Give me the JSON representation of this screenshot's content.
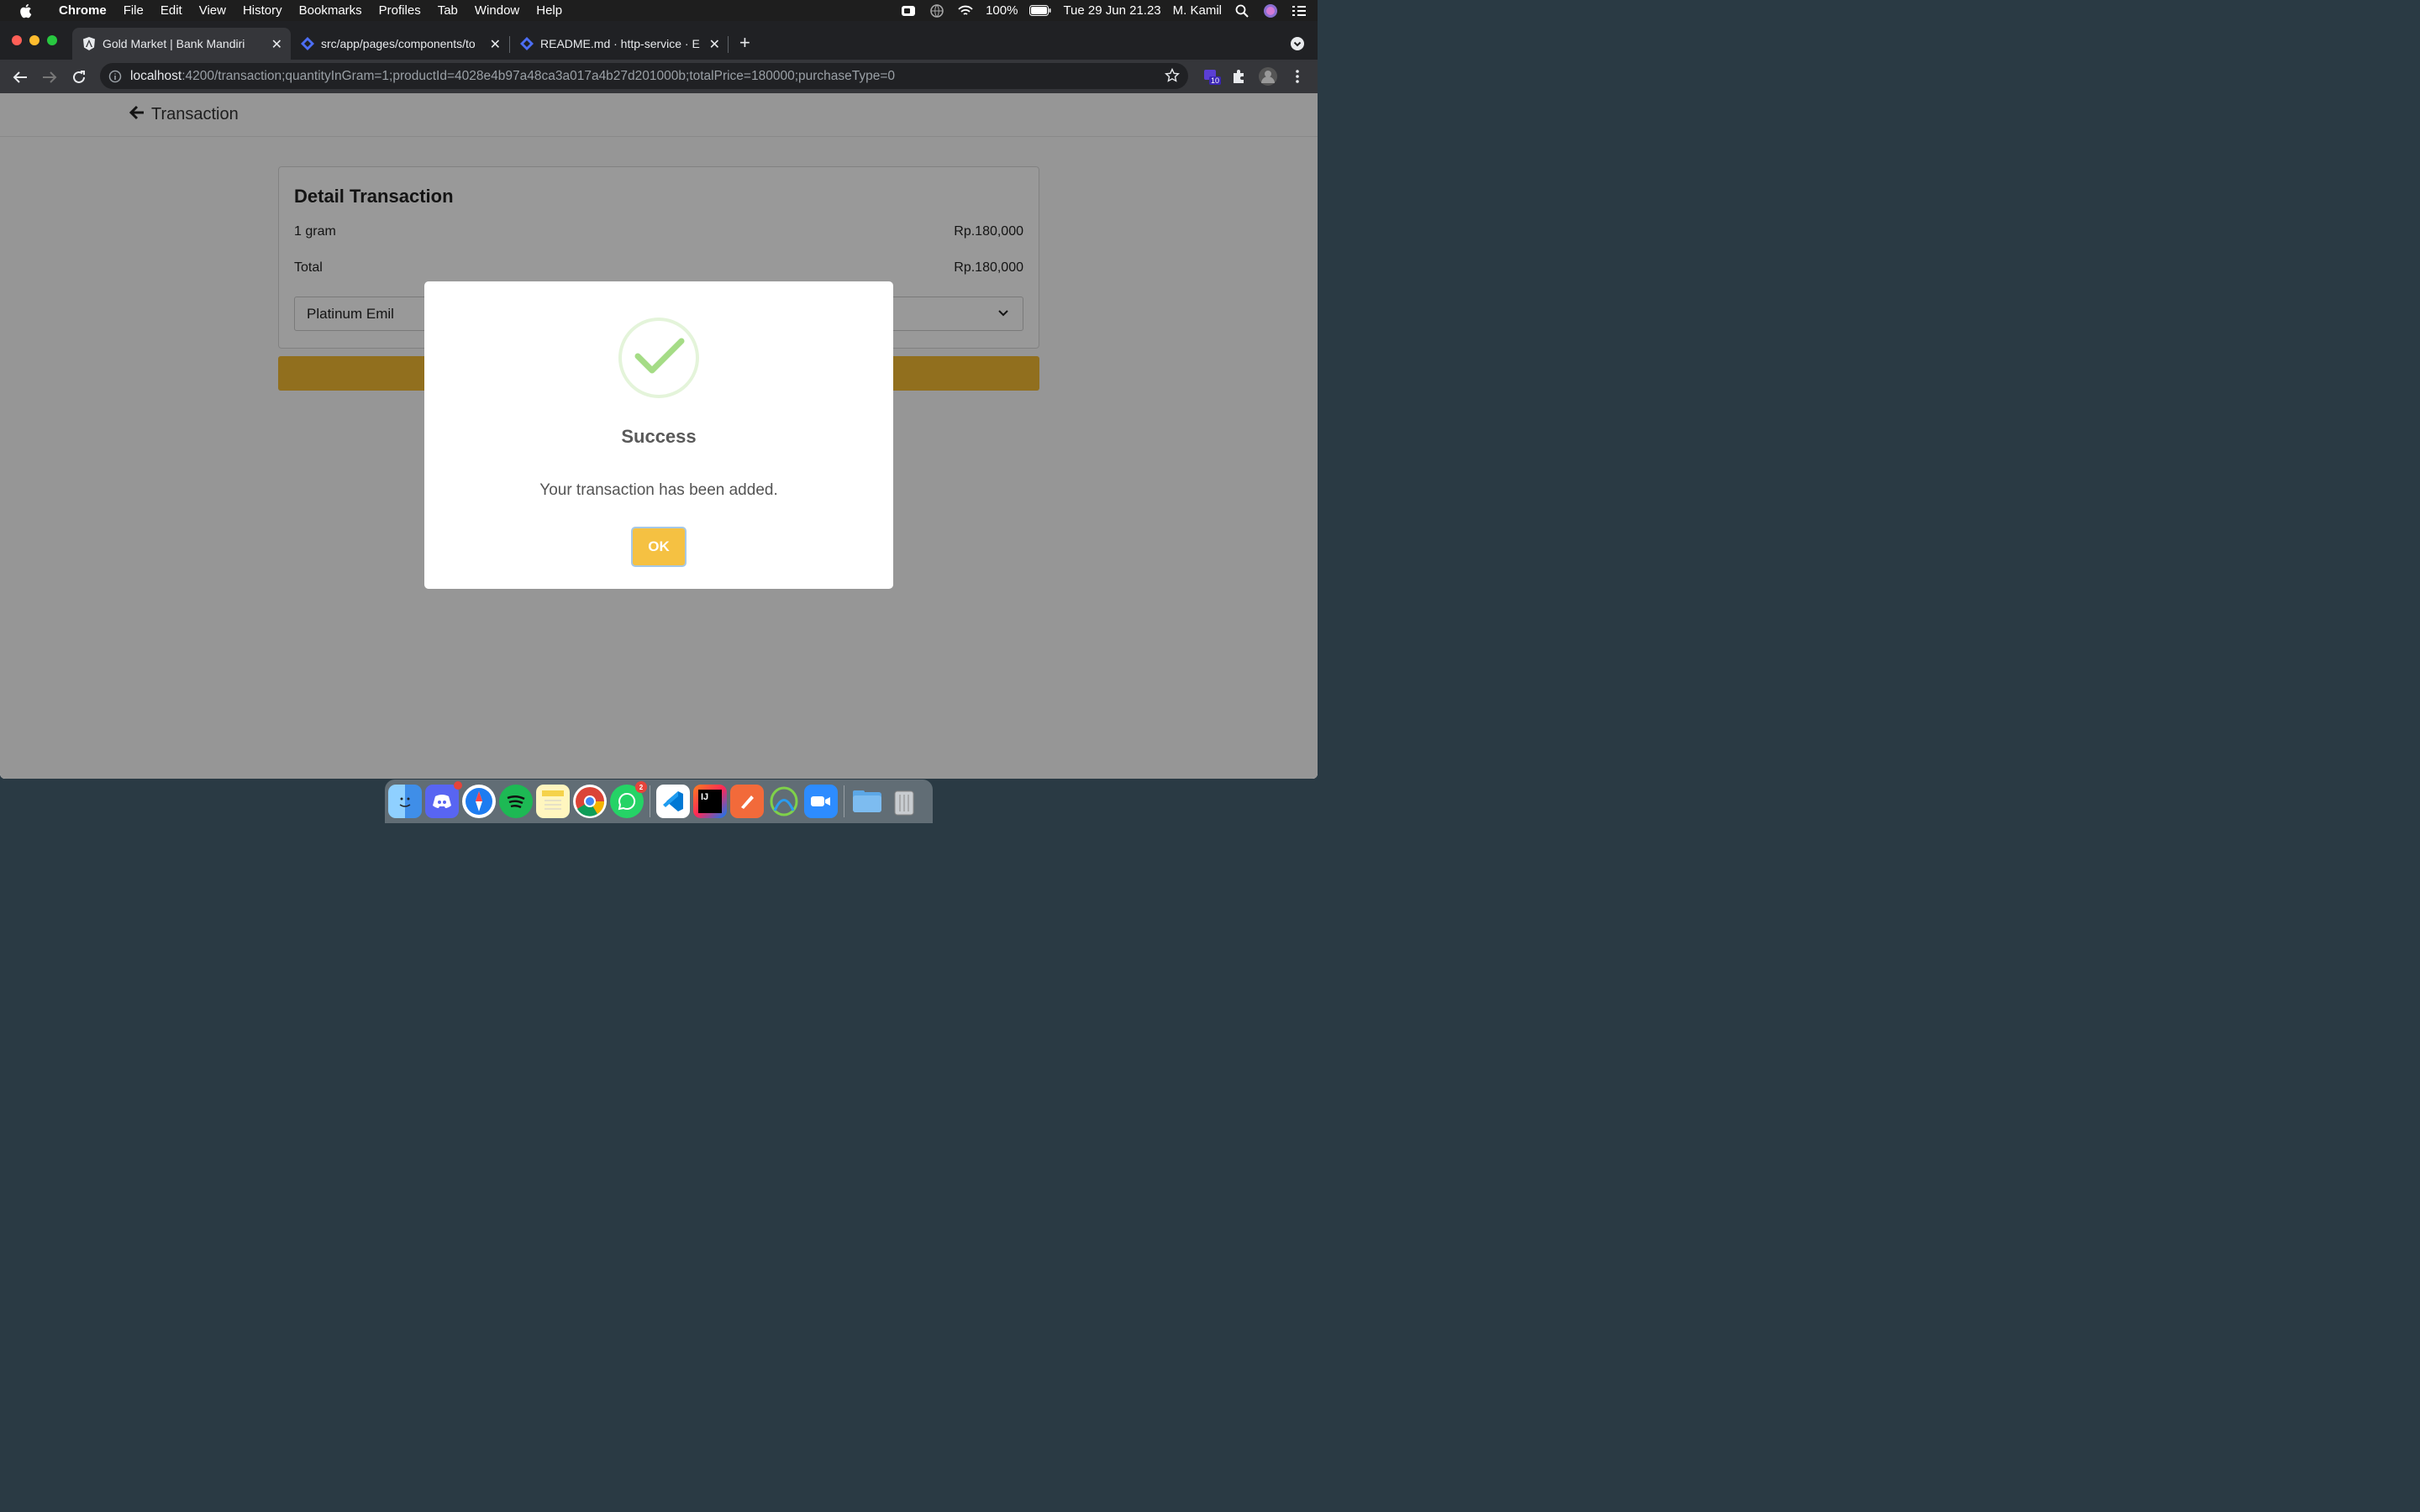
{
  "menubar": {
    "app_name": "Chrome",
    "items": [
      "File",
      "Edit",
      "View",
      "History",
      "Bookmarks",
      "Profiles",
      "Tab",
      "Window",
      "Help"
    ],
    "battery": "100%",
    "datetime": "Tue 29 Jun  21.23",
    "user": "M. Kamil"
  },
  "tabs": [
    {
      "title": "Gold Market | Bank Mandiri",
      "active": true,
      "icon": "angular-icon"
    },
    {
      "title": "src/app/pages/components/to",
      "active": false,
      "icon": "jira-icon"
    },
    {
      "title": "README.md · http-service · En",
      "active": false,
      "icon": "jira-icon"
    }
  ],
  "address": {
    "host": "localhost",
    "path": ":4200/transaction;quantityInGram=1;productId=4028e4b97a48ca3a017a4b27d201000b;totalPrice=180000;purchaseType=0"
  },
  "extensions": {
    "badge_count": "10"
  },
  "page": {
    "header_title": "Transaction",
    "card_title": "Detail Transaction",
    "rows": [
      {
        "label": "1 gram",
        "value": "Rp.180,000"
      },
      {
        "label": "Total",
        "value": "Rp.180,000"
      }
    ],
    "select_value": "Platinum Emil"
  },
  "modal": {
    "title": "Success",
    "text": "Your transaction has been added.",
    "ok_label": "OK"
  },
  "dock": {
    "discord_badge": "",
    "whatsapp_badge": "2"
  },
  "colors": {
    "accent_gold": "#f2b932",
    "success_green": "#a5dc86"
  }
}
